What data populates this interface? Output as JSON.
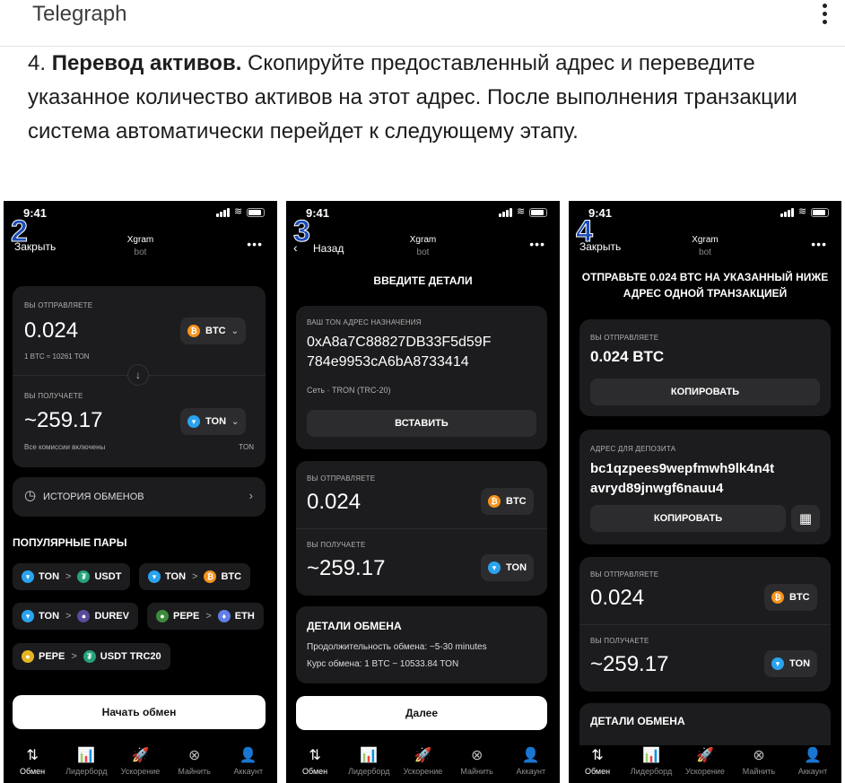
{
  "telegraph": {
    "title": "Telegraph"
  },
  "article": {
    "number": "4.",
    "bold": "Перевод активов.",
    "text": "Скопируйте предоставленный адрес и переведите указанное количество активов на этот адрес. После выполнения транзакции система автоматически перейдет к следующему этапу."
  },
  "common": {
    "time": "9:41",
    "bot_name": "Xgram",
    "bot_sub": "bot",
    "more": "•••",
    "tabs": [
      "Обмен",
      "Лидерборд",
      "Ускорение",
      "Майнить",
      "Аккаунт"
    ],
    "tab_icons": [
      "⇅",
      "📊",
      "🚀",
      "⊗",
      "👤"
    ]
  },
  "phone2": {
    "step": "2",
    "nav_left": "Закрыть",
    "send_label": "ВЫ ОТПРАВЛЯЕТЕ",
    "send_amount": "0.024",
    "send_coin": "BTC",
    "rate": "1 BTC ≈ 10261 TON",
    "recv_label": "ВЫ ПОЛУЧАЕТЕ",
    "recv_amount": "~259.17",
    "recv_coin": "TON",
    "fees_note": "Все комиссии включены",
    "fees_coin": "TON",
    "history": "ИСТОРИЯ ОБМЕНОВ",
    "popular_title": "ПОПУЛЯРНЫЕ ПАРЫ",
    "pairs": [
      {
        "from": "TON",
        "to": "USDT"
      },
      {
        "from": "TON",
        "to": "BTC"
      },
      {
        "from": "TON",
        "to": "DUREV"
      },
      {
        "from": "PEPE",
        "to": "ETH"
      },
      {
        "from": "PEPE",
        "to": "USDT TRC20"
      }
    ],
    "start_button": "Начать обмен"
  },
  "phone3": {
    "step": "3",
    "nav_left": "Назад",
    "title": "ВВЕДИТЕ ДЕТАЛИ",
    "addr_label": "ВАШ TON АДРЕС НАЗНАЧЕНИЯ",
    "addr_line1": "0xA8a7C88827DB33F5d59F",
    "addr_line2": "784e9953cA6bA8733414",
    "network": "Сеть · TRON (TRC-20)",
    "paste_button": "ВСТАВИТЬ",
    "send_label": "ВЫ ОТПРАВЛЯЕТЕ",
    "send_amount": "0.024",
    "send_coin": "BTC",
    "recv_label": "ВЫ ПОЛУЧАЕТЕ",
    "recv_amount": "~259.17",
    "recv_coin": "TON",
    "details_title": "ДЕТАЛИ ОБМЕНА",
    "duration": "Продолжительность обмена: ~5-30 minutes",
    "rate": "Курс обмена: 1 BTC ~ 10533.84 TON",
    "next_button": "Далее"
  },
  "phone4": {
    "step": "4",
    "nav_left": "Закрыть",
    "heading_pre": "ОТПРАВЬТЕ ",
    "heading_bold": "0.024 BTC",
    "heading_post": " НА УКАЗАННЫЙ НИЖЕ АДРЕС ОДНОЙ ТРАНЗАКЦИЕЙ",
    "send_label": "ВЫ ОТПРАВЛЯЕТЕ",
    "send_value": "0.024 BTC",
    "copy_button": "КОПИРОВАТЬ",
    "deposit_label": "АДРЕС ДЛЯ ДЕПОЗИТА",
    "deposit_line1": "bc1qzpees9wepfmwh9lk4n4t",
    "deposit_line2": "avryd89jnwgf6nauu4",
    "copy_button2": "КОПИРОВАТЬ",
    "send_label2": "ВЫ ОТПРАВЛЯЕТЕ",
    "send_amount": "0.024",
    "send_coin": "BTC",
    "recv_label": "ВЫ ПОЛУЧАЕТЕ",
    "recv_amount": "~259.17",
    "recv_coin": "TON",
    "details_title": "ДЕТАЛИ ОБМЕНА"
  }
}
